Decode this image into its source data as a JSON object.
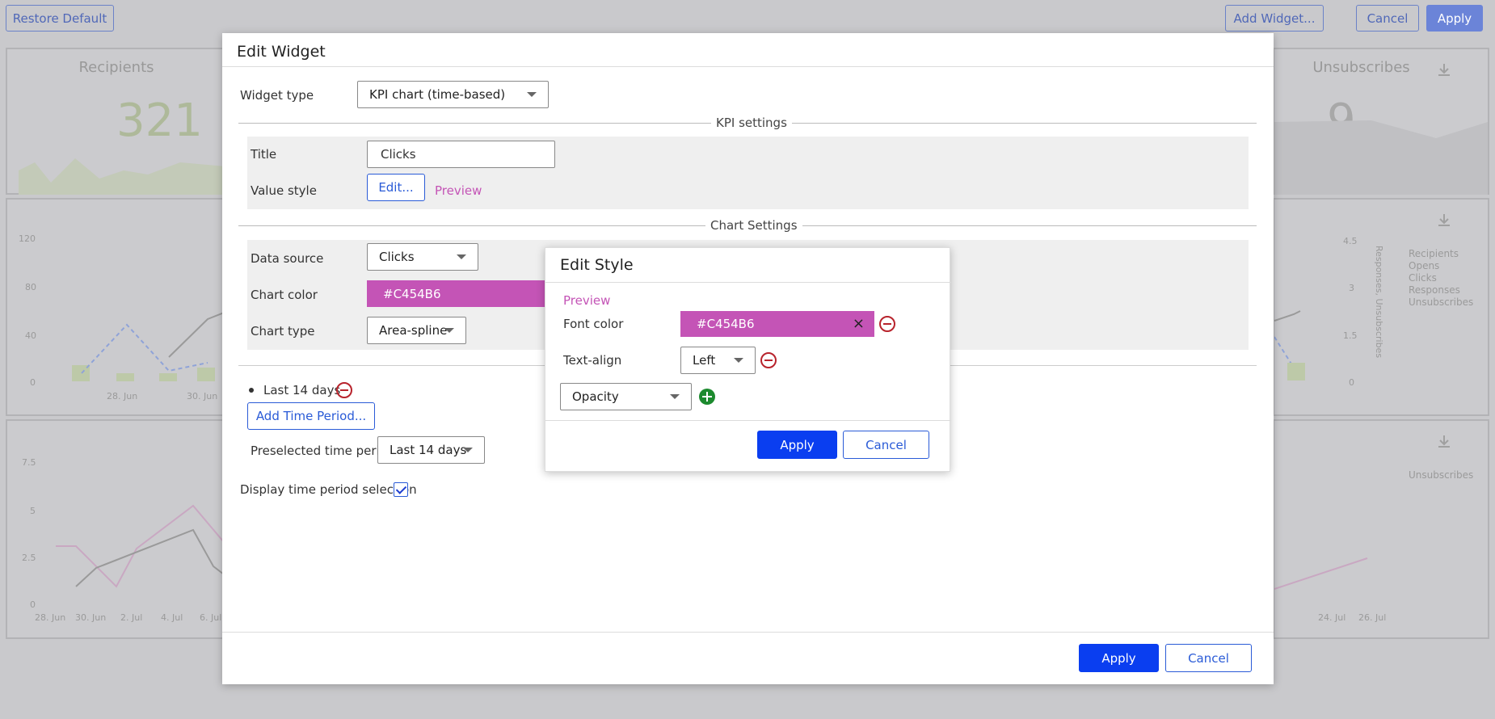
{
  "toolbar": {
    "restore_default": "Restore Default",
    "add_widget": "Add Widget...",
    "cancel": "Cancel",
    "apply": "Apply"
  },
  "background": {
    "recipients_title": "Recipients",
    "recipients_value": "321",
    "unsubscribes_title": "Unsubscribes",
    "unsubscribes_value": "9",
    "chart1": {
      "y_ticks": [
        "120",
        "80",
        "40",
        "0"
      ],
      "x_ticks": [
        "28. Jun",
        "30. Jun"
      ],
      "right_ticks": [
        "4.5",
        "3",
        "1.5",
        "0"
      ],
      "right_axis_label": "Responses, Unsubscribes",
      "legend": [
        "Recipients",
        "Opens",
        "Clicks",
        "Responses",
        "Unsubscribes"
      ]
    },
    "chart2": {
      "y_ticks": [
        "7.5",
        "5",
        "2.5",
        "0"
      ],
      "x_ticks": [
        "28. Jun",
        "30. Jun",
        "2. Jul",
        "4. Jul",
        "6. Jul"
      ],
      "x_ticks_right": [
        "24. Jul",
        "26. Jul"
      ],
      "legend": [
        "Unsubscribes"
      ]
    }
  },
  "edit_widget": {
    "title": "Edit Widget",
    "widget_type_label": "Widget type",
    "widget_type_value": "KPI chart (time-based)",
    "kpi_section": "KPI settings",
    "title_label": "Title",
    "title_value": "Clicks",
    "value_style_label": "Value style",
    "edit_button": "Edit...",
    "preview_link": "Preview",
    "chart_section": "Chart Settings",
    "data_source_label": "Data source",
    "data_source_value": "Clicks",
    "chart_color_label": "Chart color",
    "chart_color_value": "#C454B6",
    "chart_type_label": "Chart type",
    "chart_type_value": "Area-spline",
    "time_periods": [
      "Last 14 days"
    ],
    "add_time_period": "Add Time Period...",
    "preselected_label": "Preselected time period",
    "preselected_value": "Last 14 days",
    "display_selection_label": "Display time period selection",
    "display_selection_checked": true,
    "apply": "Apply",
    "cancel": "Cancel"
  },
  "edit_style": {
    "title": "Edit Style",
    "preview": "Preview",
    "font_color_label": "Font color",
    "font_color_value": "#C454B6",
    "clear_symbol": "×",
    "text_align_label": "Text-align",
    "text_align_value": "Left",
    "add_property_value": "Opacity",
    "apply": "Apply",
    "cancel": "Cancel"
  },
  "colors": {
    "accent": "#C454B6",
    "primary": "#0A3EF0",
    "remove": "#B8232C",
    "add": "#1C8A2E"
  }
}
